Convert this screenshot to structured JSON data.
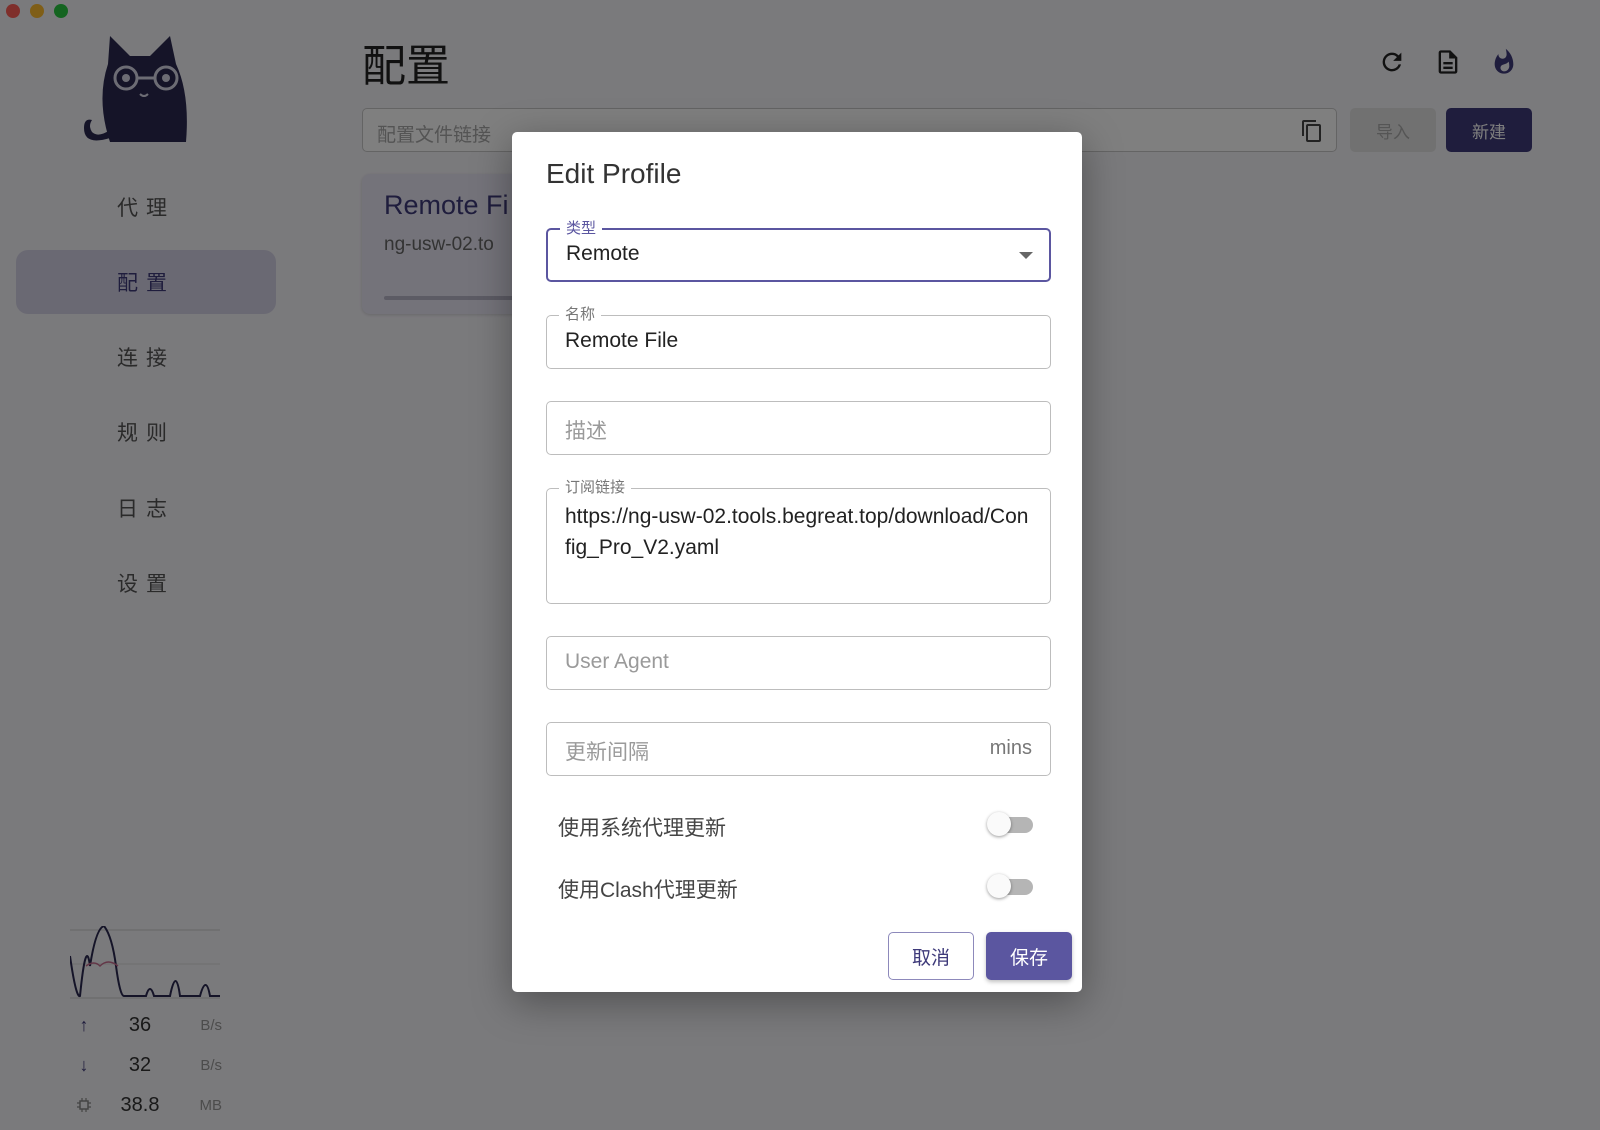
{
  "window": {
    "controls": [
      "close",
      "minimize",
      "zoom"
    ]
  },
  "sidebar": {
    "logo_icon": "cat-logo-icon",
    "items": [
      {
        "label": "代理",
        "active": false
      },
      {
        "label": "配置",
        "active": true
      },
      {
        "label": "连接",
        "active": false
      },
      {
        "label": "规则",
        "active": false
      },
      {
        "label": "日志",
        "active": false
      },
      {
        "label": "设置",
        "active": false
      }
    ],
    "stats": {
      "upload": {
        "icon": "arrow-up-icon",
        "value": "36",
        "unit": "B/s"
      },
      "download": {
        "icon": "arrow-down-icon",
        "value": "32",
        "unit": "B/s"
      },
      "memory": {
        "icon": "memory-chip-icon",
        "value": "38.8",
        "unit": "MB"
      }
    }
  },
  "main": {
    "title": "配置",
    "header_icons": [
      "refresh-icon",
      "document-icon",
      "flame-icon"
    ],
    "url_input": {
      "placeholder": "配置文件链接",
      "value": ""
    },
    "import_label": "导入",
    "new_label": "新建",
    "profile_card": {
      "title": "Remote Fi",
      "subtitle": "ng-usw-02.to"
    }
  },
  "dialog": {
    "title": "Edit Profile",
    "type": {
      "label": "类型",
      "value": "Remote"
    },
    "name": {
      "label": "名称",
      "value": "Remote File"
    },
    "desc": {
      "placeholder": "描述",
      "value": ""
    },
    "url": {
      "label": "订阅链接",
      "value": "https://ng-usw-02.tools.begreat.top/download/Config_Pro_V2.yaml"
    },
    "user_agent": {
      "placeholder": "User Agent",
      "value": ""
    },
    "interval": {
      "placeholder": "更新间隔",
      "suffix": "mins",
      "value": ""
    },
    "system_proxy": {
      "label": "使用系统代理更新",
      "on": false
    },
    "clash_proxy": {
      "label": "使用Clash代理更新",
      "on": false
    },
    "cancel_label": "取消",
    "save_label": "保存"
  },
  "colors": {
    "accent": "#5b56a0",
    "accent_dark": "#3e3a7a",
    "sidebar_active": "#d4d2e6",
    "backdrop": "rgba(0,0,0,0.5)"
  }
}
